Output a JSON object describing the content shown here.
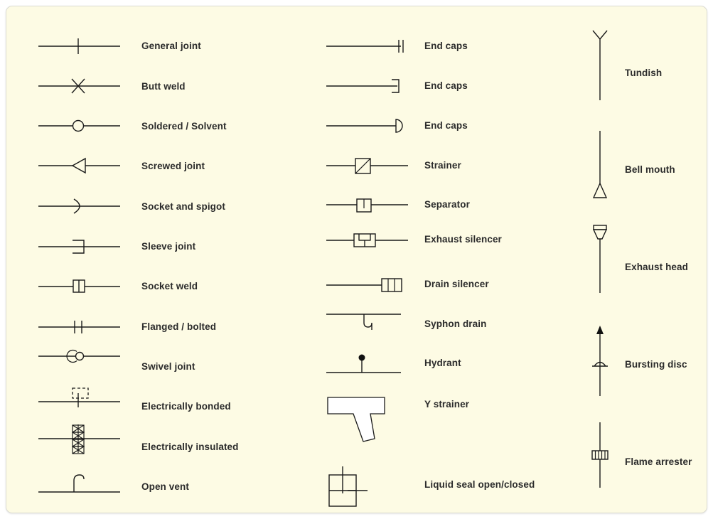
{
  "sheet": {
    "background_color": "#fdfbe4",
    "border_color": "#dcdcd4",
    "line_color": "#1a1a1a",
    "text_color": "#2b2b2b"
  },
  "columns": [
    {
      "name": "pipe-joints-column",
      "items": [
        {
          "label": "General joint",
          "symbol": "general-joint-symbol"
        },
        {
          "label": "Butt weld",
          "symbol": "butt-weld-symbol"
        },
        {
          "label": "Soldered / Solvent",
          "symbol": "soldered-solvent-symbol"
        },
        {
          "label": "Screwed joint",
          "symbol": "screwed-joint-symbol"
        },
        {
          "label": "Socket and spigot",
          "symbol": "socket-and-spigot-symbol"
        },
        {
          "label": "Sleeve joint",
          "symbol": "sleeve-joint-symbol"
        },
        {
          "label": "Socket weld",
          "symbol": "socket-weld-symbol"
        },
        {
          "label": "Flanged / bolted",
          "symbol": "flanged-bolted-symbol"
        },
        {
          "label": "Swivel joint",
          "symbol": "swivel-joint-symbol"
        },
        {
          "label": "Electrically bonded",
          "symbol": "electrically-bonded-symbol"
        },
        {
          "label": "Electrically insulated",
          "symbol": "electrically-insulated-symbol"
        },
        {
          "label": "Open vent",
          "symbol": "open-vent-symbol"
        }
      ]
    },
    {
      "name": "fittings-column",
      "items": [
        {
          "label": "End caps",
          "symbol": "end-cap-flat-symbol"
        },
        {
          "label": "End caps",
          "symbol": "end-cap-square-symbol"
        },
        {
          "label": "End caps",
          "symbol": "end-cap-round-symbol"
        },
        {
          "label": "Strainer",
          "symbol": "strainer-symbol"
        },
        {
          "label": "Separator",
          "symbol": "separator-symbol"
        },
        {
          "label": "Exhaust silencer",
          "symbol": "exhaust-silencer-symbol"
        },
        {
          "label": "Drain silencer",
          "symbol": "drain-silencer-symbol"
        },
        {
          "label": "Syphon drain",
          "symbol": "syphon-drain-symbol"
        },
        {
          "label": "Hydrant",
          "symbol": "hydrant-symbol"
        },
        {
          "label": "Y strainer",
          "symbol": "y-strainer-symbol"
        },
        {
          "label": "Liquid seal open/closed",
          "symbol": "liquid-seal-symbol"
        }
      ]
    },
    {
      "name": "vertical-devices-column",
      "items": [
        {
          "label": "Tundish",
          "symbol": "tundish-symbol"
        },
        {
          "label": "Bell mouth",
          "symbol": "bell-mouth-symbol"
        },
        {
          "label": "Exhaust head",
          "symbol": "exhaust-head-symbol"
        },
        {
          "label": "Bursting disc",
          "symbol": "bursting-disc-symbol"
        },
        {
          "label": "Flame arrester",
          "symbol": "flame-arrester-symbol"
        }
      ]
    }
  ]
}
